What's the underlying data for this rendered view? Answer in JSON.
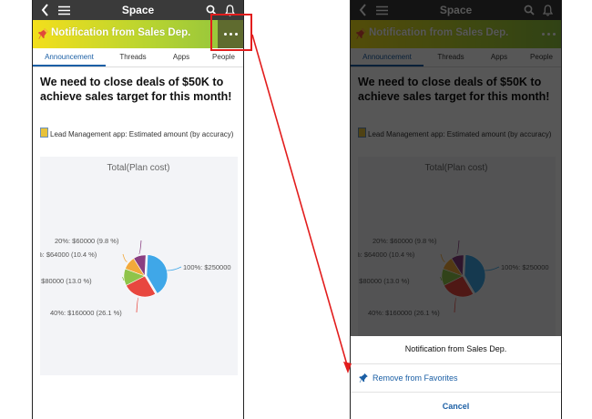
{
  "nav": {
    "title": "Space",
    "back_icon": "back-chevron-icon",
    "menu_icon": "hamburger-menu-icon",
    "search_icon": "search-icon",
    "notification_icon": "bell-icon"
  },
  "banner": {
    "title": "Notification from Sales Dep.",
    "pin_icon": "pushpin-icon",
    "more_icon": "more-dots-icon",
    "gradient": [
      "#f3df1c",
      "#8ec23f"
    ]
  },
  "tabs": [
    {
      "label": "Announcement",
      "active": true
    },
    {
      "label": "Threads",
      "active": false
    },
    {
      "label": "Apps",
      "active": false
    },
    {
      "label": "People",
      "active": false
    }
  ],
  "post": {
    "headline": "We need to close deals of $50K to achieve sales target for this month!",
    "app_reference": "Lead Management app: Estimated amount (by accuracy)"
  },
  "chart_data": {
    "type": "pie",
    "title": "Total(Plan cost)",
    "slices": [
      {
        "label": "100%",
        "value": 250000,
        "percent": 40.8,
        "color": "#3fa7e8",
        "data_label": "100%: $250000"
      },
      {
        "label": "40%",
        "value": 160000,
        "percent": 26.1,
        "color": "#e8473f",
        "data_label": "40%: $160000 (26.1 %)"
      },
      {
        "label": "",
        "value": 80000,
        "percent": 13.0,
        "color": "#8fc44a",
        "data_label": ": $80000 (13.0 %)"
      },
      {
        "label": "",
        "value": 64000,
        "percent": 10.4,
        "color": "#f2a93b",
        "data_label": "%: $64000 (10.4 %)"
      },
      {
        "label": "20%",
        "value": 60000,
        "percent": 9.8,
        "color": "#8a3f82",
        "data_label": "20%: $60000 (9.8 %)"
      }
    ]
  },
  "sheet": {
    "title": "Notification from Sales Dep.",
    "remove_label": "Remove from Favorites",
    "cancel_label": "Cancel"
  },
  "annotation": {
    "color": "#e21d1d"
  }
}
